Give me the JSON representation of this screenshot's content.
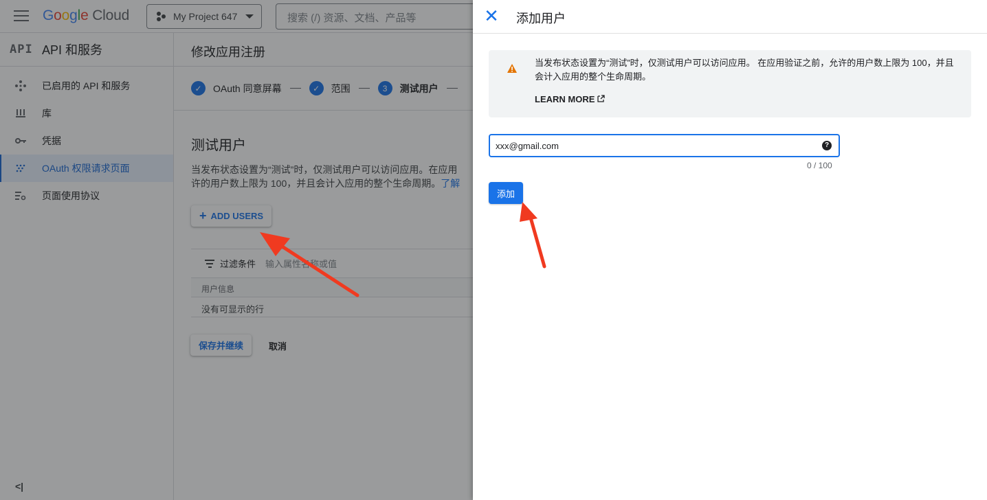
{
  "topbar": {
    "logo": {
      "g1": "G",
      "g2": "o",
      "g3": "o",
      "g4": "g",
      "g5": "l",
      "g6": "e",
      "cloud": "Cloud"
    },
    "project": "My Project 647",
    "search_placeholder": "搜索 (/) 资源、文档、产品等"
  },
  "sidebar": {
    "api_mark": "API",
    "title": "API 和服务",
    "items": [
      {
        "label": "已启用的 API 和服务",
        "icon": "diamond-dots-icon",
        "active": false
      },
      {
        "label": "库",
        "icon": "library-icon",
        "active": false
      },
      {
        "label": "凭据",
        "icon": "key-icon",
        "active": false
      },
      {
        "label": "OAuth 权限请求页面",
        "icon": "oauth-dots-icon",
        "active": true
      },
      {
        "label": "页面使用协议",
        "icon": "list-settings-icon",
        "active": false
      }
    ],
    "collapse_label": "<|"
  },
  "main": {
    "title": "修改应用注册",
    "steps": [
      {
        "number": "✓",
        "label": "OAuth 同意屏幕"
      },
      {
        "number": "✓",
        "label": "范围"
      },
      {
        "number": "3",
        "label": "测试用户"
      }
    ],
    "section_title": "测试用户",
    "section_desc": "当发布状态设置为“测试”时，仅测试用户可以访问应用。在应用",
    "section_desc2": "许的用户数上限为 100，并且会计入应用的整个生命周期。",
    "section_desc_link": "了解",
    "add_users_label": "ADD USERS",
    "filter_label": "过滤条件",
    "filter_placeholder": "输入属性名称或值",
    "table_header": "用户信息",
    "table_empty": "没有可显示的行",
    "save_label": "保存并继续",
    "cancel_label": "取消"
  },
  "panel": {
    "title": "添加用户",
    "notice_text": "当发布状态设置为“测试”时，仅测试用户可以访问应用。 在应用验证之前，允许的用户数上限为 100，并且会计入应用的整个生命周期。",
    "learn_more": "LEARN MORE",
    "email_value": "xxx@gmail.com",
    "counter": "0 / 100",
    "add_label": "添加"
  },
  "colors": {
    "accent": "#1a73e8",
    "warning": "#e37400",
    "annotation_arrow": "#f03a20"
  }
}
